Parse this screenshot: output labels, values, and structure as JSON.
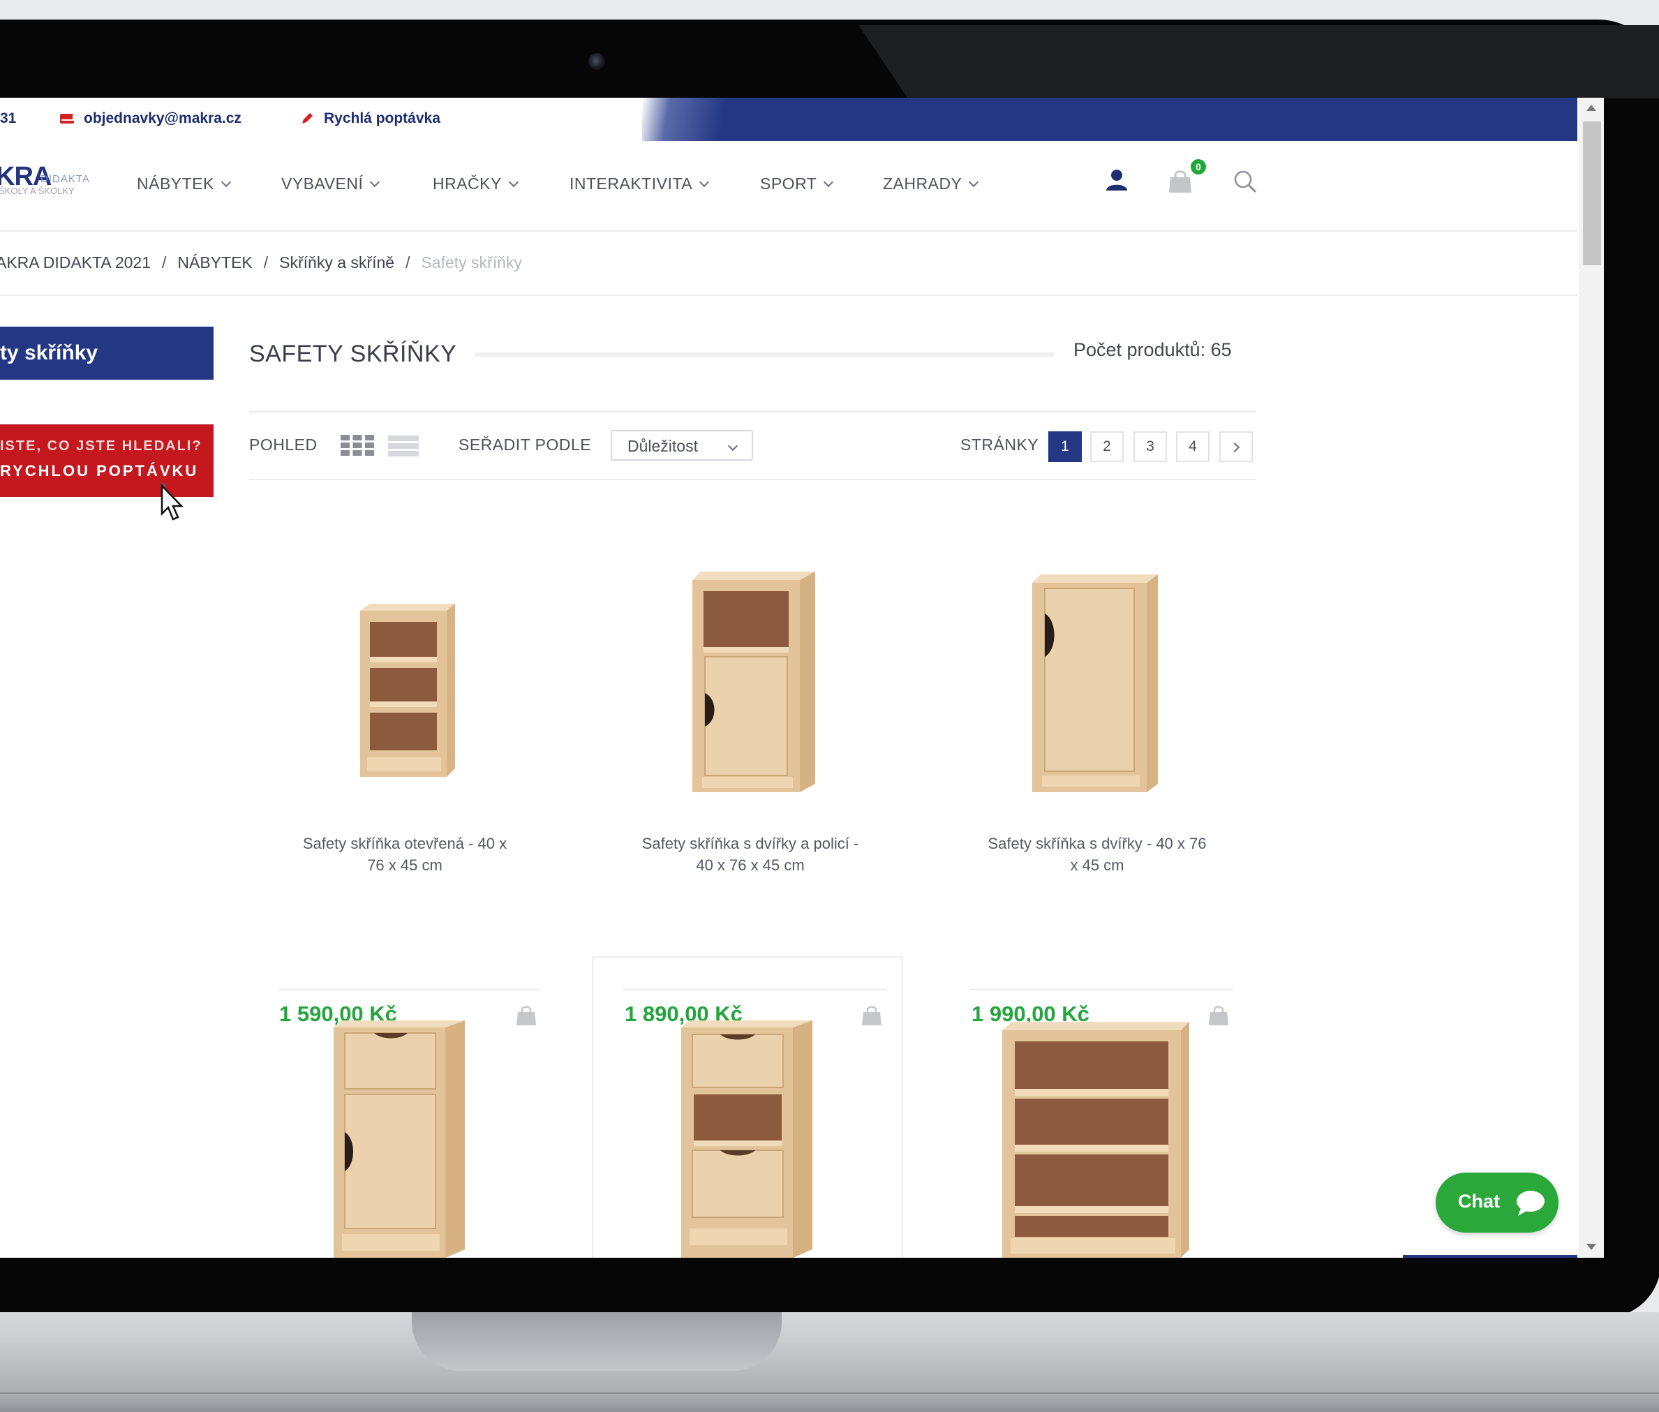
{
  "topbar": {
    "phone_fragment": "31",
    "email": "objednavky@makra.cz",
    "quick_inquiry": "Rychlá poptávka"
  },
  "logo": {
    "main": "KRA",
    "sub1": "DIDAKTA",
    "sub2": "ŠKOLY A ŠKOLKY"
  },
  "nav": {
    "items": [
      "NÁBYTEK",
      "VYBAVENÍ",
      "HRAČKY",
      "INTERAKTIVITA",
      "SPORT",
      "ZAHRADY"
    ],
    "cart_count": "0"
  },
  "breadcrumb": {
    "items": [
      "AKRA DIDAKTA 2021",
      "NÁBYTEK",
      "Skříňky a skříně"
    ],
    "current": "Safety skříňky",
    "separator": "/"
  },
  "sidebar": {
    "title": "ty skříňky",
    "promo_line1": "ISTE, CO JSTE HLEDALI?",
    "promo_line2": "RYCHLOU POPTÁVKU"
  },
  "listing": {
    "title": "SAFETY SKŘÍŇKY",
    "count_label": "Počet produktů: 65",
    "view_label": "POHLED",
    "sort_label": "SEŘADIT PODLE",
    "sort_value": "Důležitost",
    "pages_label": "STRÁNKY",
    "pages": [
      "1",
      "2",
      "3",
      "4"
    ],
    "active_page": "1"
  },
  "products": [
    {
      "name_line1": "Safety skříňka otevřená - 40 x",
      "name_line2": "76 x 45 cm",
      "price": "1 590,00 Kč",
      "image": "open-shelf-cabinet"
    },
    {
      "name_line1": "Safety skříňka s dvířky a policí -",
      "name_line2": "40 x 76 x 45 cm",
      "price": "1 890,00 Kč",
      "image": "door-and-shelf-cabinet"
    },
    {
      "name_line1": "Safety skříňka s dvířky - 40 x 76",
      "name_line2": "x 45 cm",
      "price": "1 990,00 Kč",
      "image": "door-cabinet"
    },
    {
      "image": "drawer-and-door-cabinet"
    },
    {
      "image": "two-drawer-shelf-cabinet"
    },
    {
      "image": "wide-open-shelf-cabinet"
    }
  ],
  "chat": {
    "label": "Chat"
  },
  "colors": {
    "brand_blue": "#233784",
    "promo_red": "#c4171e",
    "price_green": "#22a53c",
    "chat_green": "#2aa83a",
    "wood": "#ecd2ac"
  }
}
